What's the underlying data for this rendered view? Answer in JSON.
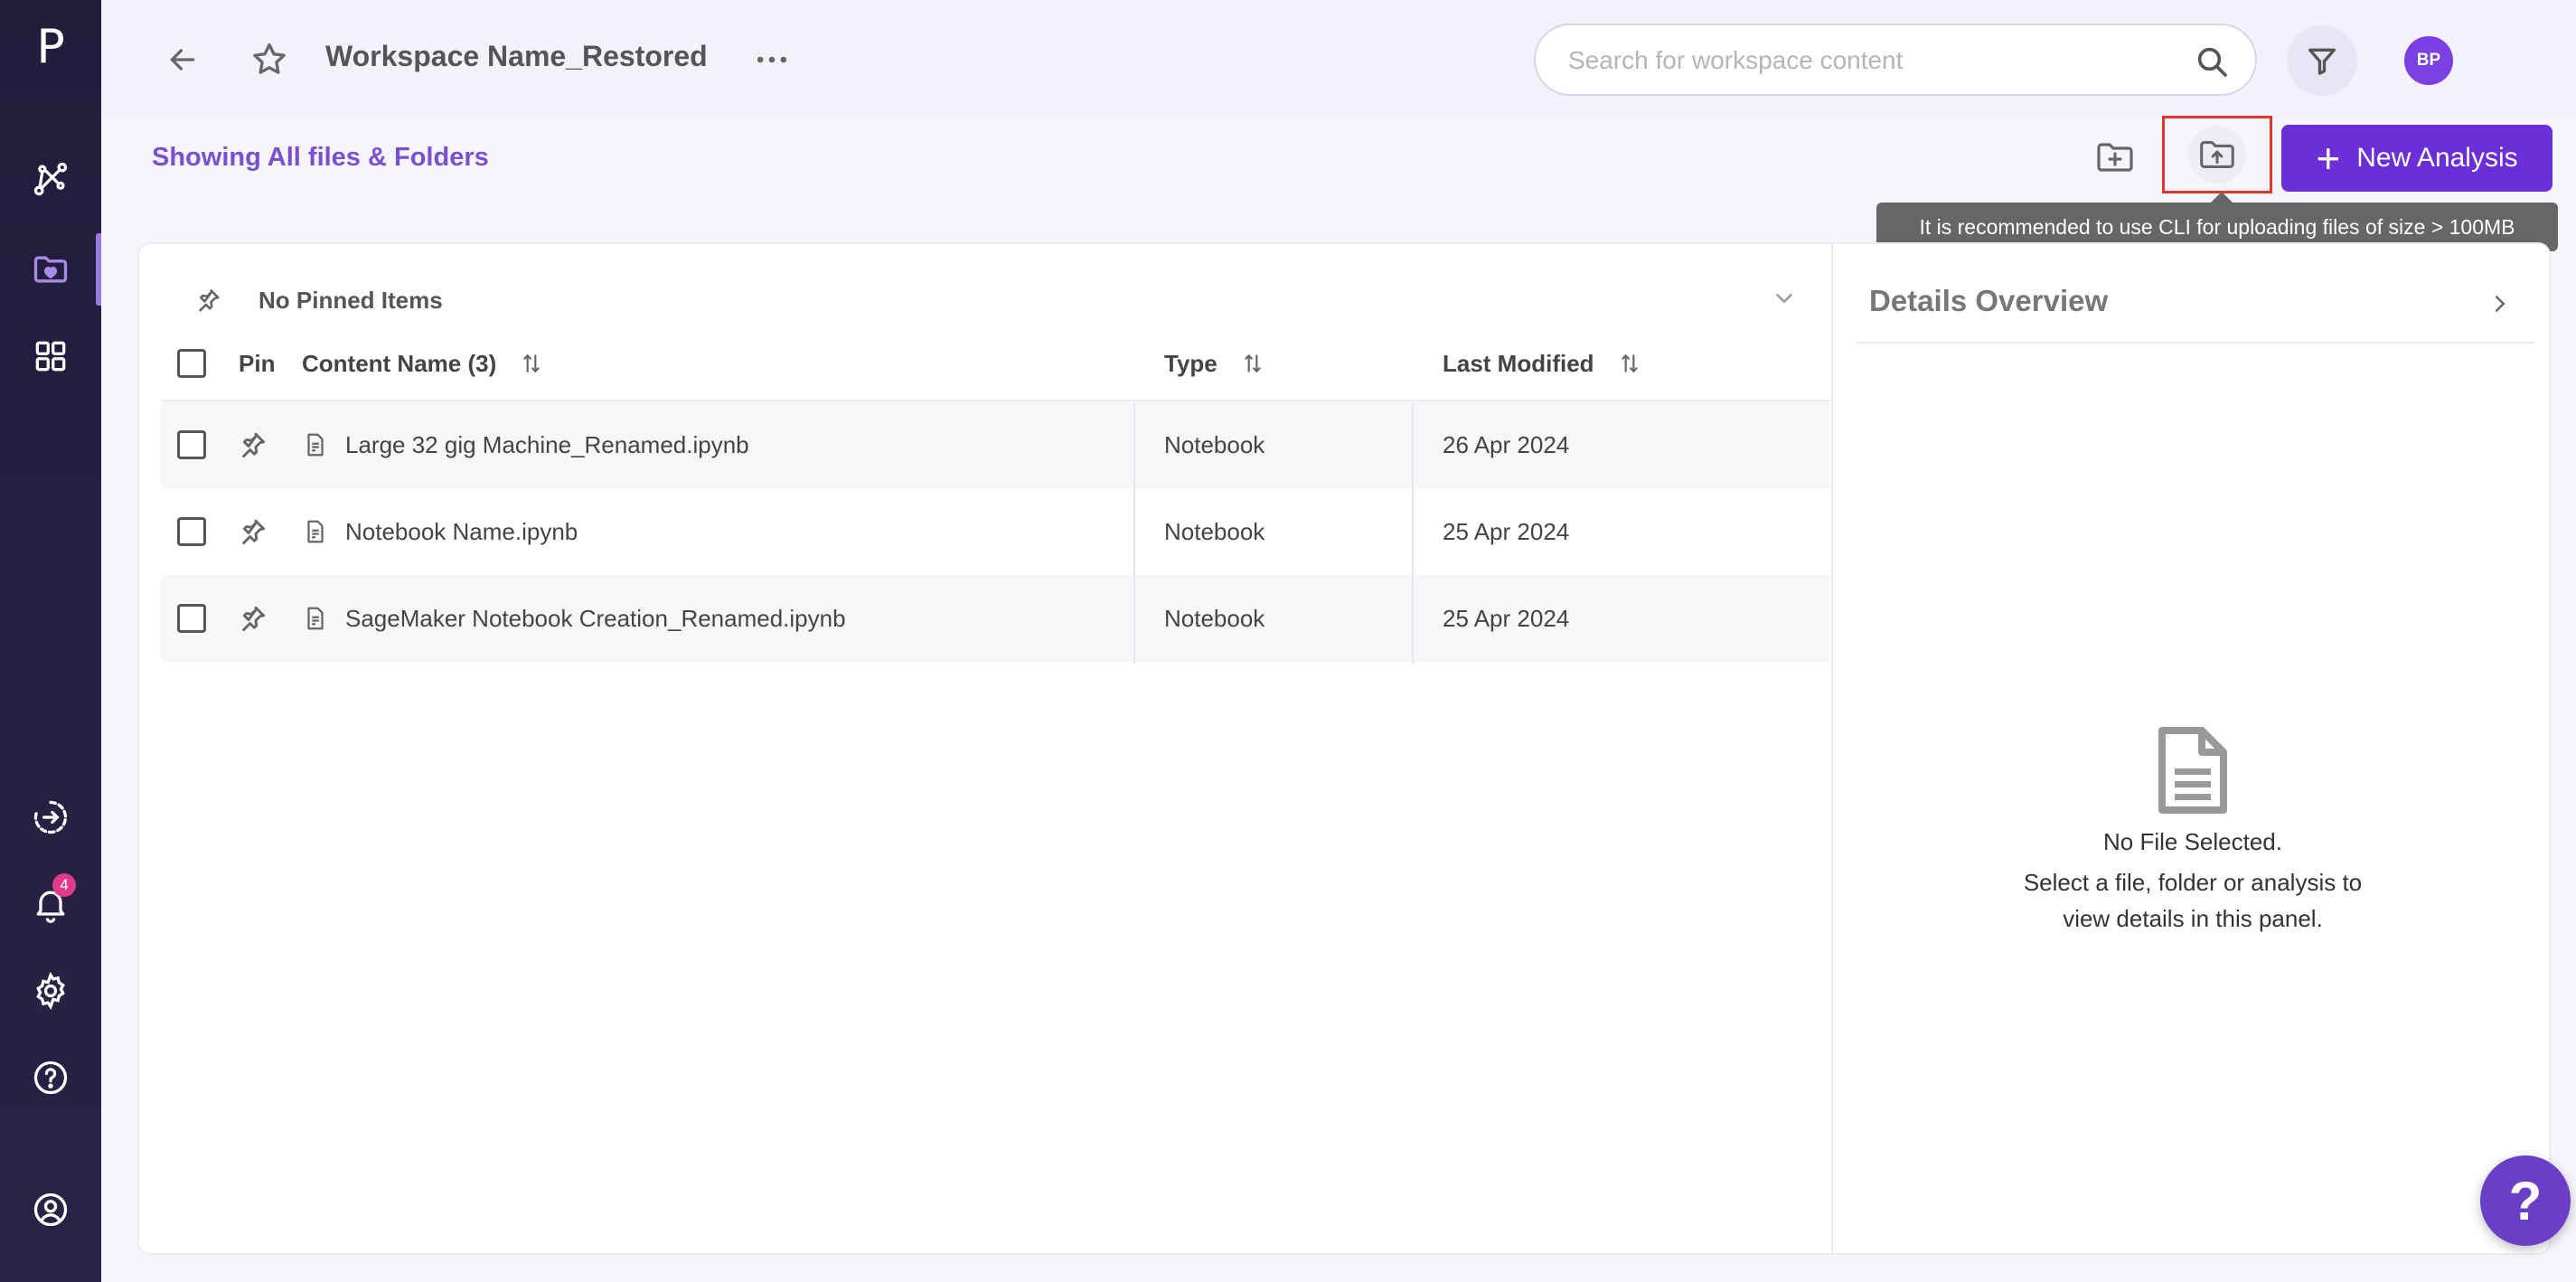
{
  "app": {
    "logo_letter": "P"
  },
  "sidebar": {
    "items": [
      {
        "name": "pipelines",
        "icon": "network-icon"
      },
      {
        "name": "workspace",
        "icon": "folder-heart-icon",
        "active": true
      },
      {
        "name": "apps",
        "icon": "grid-icon"
      },
      {
        "name": "logout",
        "icon": "exit-icon"
      },
      {
        "name": "notifications",
        "icon": "bell-icon",
        "badge": "4"
      },
      {
        "name": "settings",
        "icon": "gear-icon"
      },
      {
        "name": "help",
        "icon": "help-circle-icon"
      },
      {
        "name": "profile",
        "icon": "user-circle-icon"
      }
    ],
    "accent_color": "#9b7be0"
  },
  "header": {
    "title": "Workspace Name_Restored",
    "search_placeholder": "Search for workspace content",
    "avatar_initials": "BP"
  },
  "toolbar": {
    "subtitle": "Showing All files & Folders",
    "new_analysis_label": "New Analysis",
    "upload_tooltip": "It is recommended to use CLI for uploading files of size > 100MB",
    "primary_color": "#6a2fd6"
  },
  "pinned": {
    "label": "No Pinned Items"
  },
  "table": {
    "headers": {
      "pin": "Pin",
      "name": "Content Name (3)",
      "type": "Type",
      "modified": "Last Modified"
    },
    "rows": [
      {
        "name": "Large 32 gig Machine_Renamed.ipynb",
        "type": "Notebook",
        "modified": "26 Apr 2024"
      },
      {
        "name": "Notebook Name.ipynb",
        "type": "Notebook",
        "modified": "25 Apr 2024"
      },
      {
        "name": "SageMaker Notebook Creation_Renamed.ipynb",
        "type": "Notebook",
        "modified": "25 Apr 2024"
      }
    ]
  },
  "details": {
    "title": "Details Overview",
    "empty_title": "No File Selected.",
    "empty_line1": "Select a file, folder or analysis to",
    "empty_line2": "view details in this panel."
  },
  "help_fab": {
    "label": "?"
  }
}
